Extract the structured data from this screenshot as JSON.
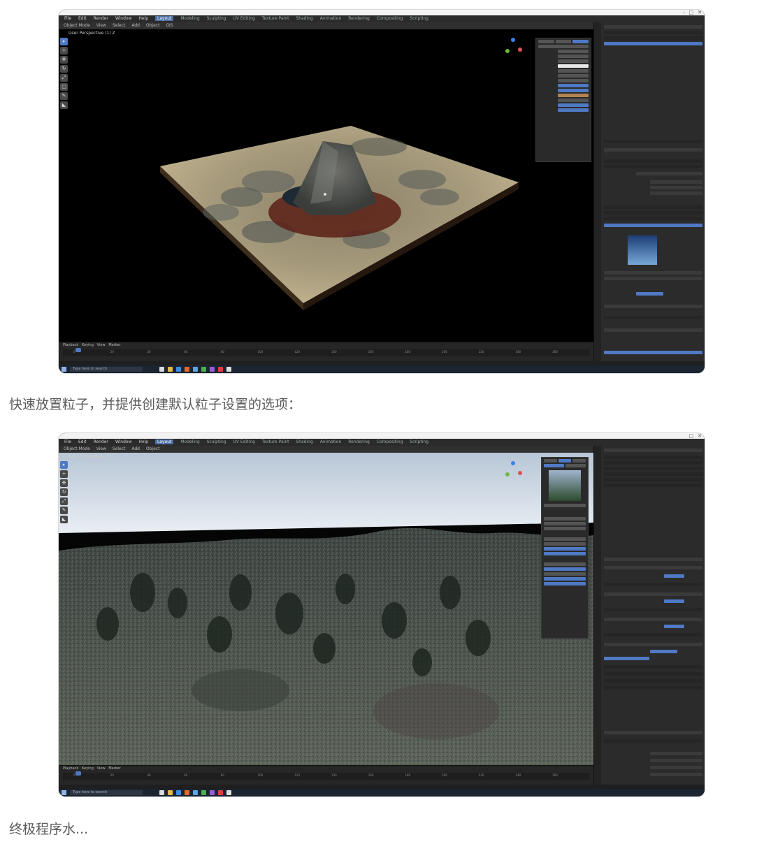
{
  "captions": {
    "first": "快速放置粒子，并提供创建默认粒子设置的选项：",
    "second": "终极程序水..."
  },
  "screenshot1": {
    "viewport_title": "User Perspective (1) Z",
    "menu_items": [
      "File",
      "Edit",
      "Render",
      "Window",
      "Help"
    ],
    "workspaces": [
      "Layout",
      "Modeling",
      "Sculpting",
      "UV Editing",
      "Texture Paint",
      "Shading",
      "Animation",
      "Rendering",
      "Compositing",
      "Scripting"
    ],
    "active_workspace": "Layout",
    "header_items": [
      "Object Mode",
      "View",
      "Select",
      "Add",
      "Object",
      "GIS"
    ],
    "timeline_items": [
      "Playback",
      "Keying",
      "View",
      "Marker"
    ],
    "timeline_ticks": [
      "0",
      "20",
      "40",
      "60",
      "80",
      "100",
      "120",
      "140",
      "160",
      "180",
      "200",
      "220",
      "240",
      "260"
    ],
    "search_text": "Type here to search",
    "accent_color": "#4f79c4"
  },
  "screenshot2": {
    "viewport_title": "User Perspective (1) Z",
    "menu_items": [
      "File",
      "Edit",
      "Render",
      "Window",
      "Help"
    ],
    "workspaces": [
      "Layout",
      "Modeling",
      "Sculpting",
      "UV Editing",
      "Texture Paint",
      "Shading",
      "Animation",
      "Rendering",
      "Compositing",
      "Scripting"
    ],
    "active_workspace": "Layout",
    "header_items": [
      "Object Mode",
      "View",
      "Select",
      "Add",
      "Object"
    ],
    "timeline_items": [
      "Playback",
      "Keying",
      "View",
      "Marker"
    ],
    "timeline_ticks": [
      "0",
      "20",
      "40",
      "60",
      "80",
      "100",
      "120",
      "140",
      "160",
      "180",
      "200",
      "220",
      "240",
      "260"
    ],
    "search_text": "Type here to search",
    "accent_color": "#4f79c4"
  }
}
